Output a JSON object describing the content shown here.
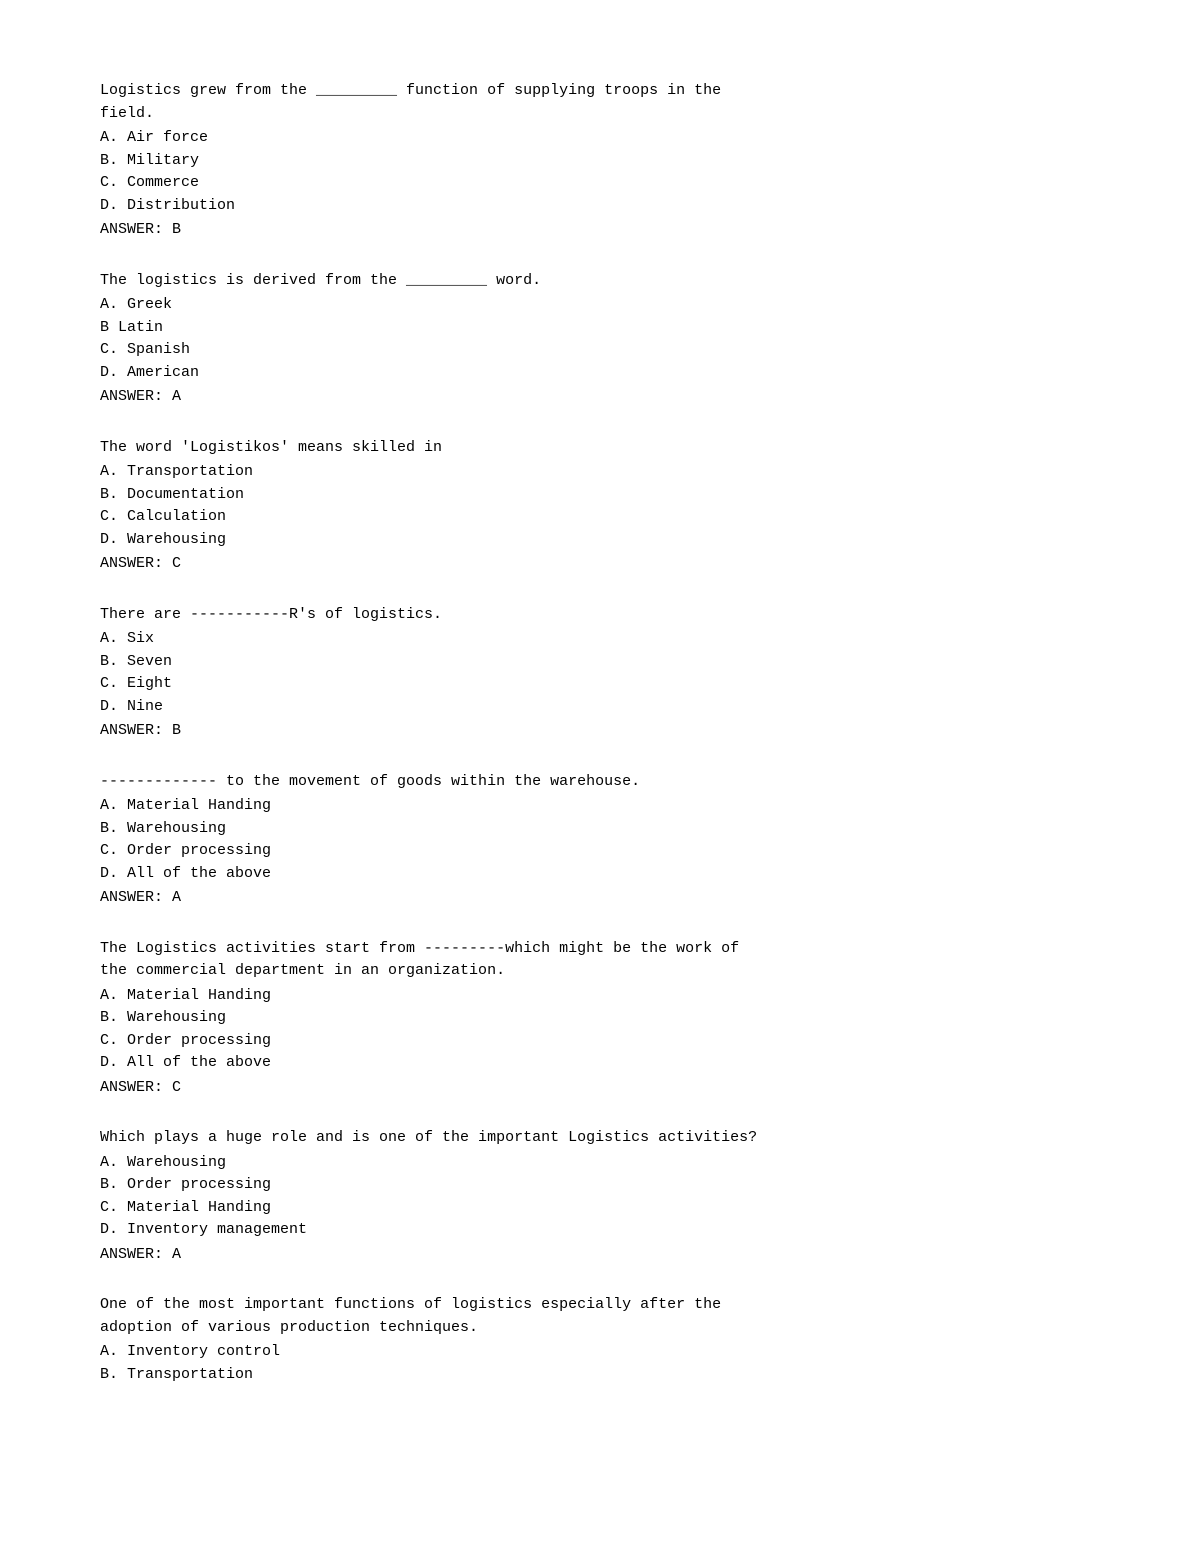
{
  "questions": [
    {
      "id": "q1",
      "text": "Logistics grew from the _________ function of supplying troops in the\nfield.",
      "options": [
        {
          "label": "A.",
          "text": "Air force"
        },
        {
          "label": "B.",
          "text": "Military"
        },
        {
          "label": "C.",
          "text": "Commerce"
        },
        {
          "label": "D.",
          "text": "Distribution"
        }
      ],
      "answer": "ANSWER: B"
    },
    {
      "id": "q2",
      "text": "The logistics is derived from the _________ word.",
      "options": [
        {
          "label": "A.",
          "text": "Greek"
        },
        {
          "label": "B",
          "text": "Latin"
        },
        {
          "label": "C.",
          "text": "Spanish"
        },
        {
          "label": "D.",
          "text": "American"
        }
      ],
      "answer": "ANSWER: A"
    },
    {
      "id": "q3",
      "text": "The word 'Logistikos' means skilled in",
      "options": [
        {
          "label": "A.",
          "text": "Transportation"
        },
        {
          "label": "B.",
          "text": "Documentation"
        },
        {
          "label": "C.",
          "text": "Calculation"
        },
        {
          "label": "D.",
          "text": "Warehousing"
        }
      ],
      "answer": "ANSWER: C"
    },
    {
      "id": "q4",
      "text": "There are -----------R's of logistics.",
      "options": [
        {
          "label": "A.",
          "text": "Six"
        },
        {
          "label": "B.",
          "text": "Seven"
        },
        {
          "label": "C.",
          "text": "Eight"
        },
        {
          "label": "D.",
          "text": "Nine"
        }
      ],
      "answer": "ANSWER: B"
    },
    {
      "id": "q5",
      "text": "------------- to the movement of goods within the warehouse.",
      "options": [
        {
          "label": "A.",
          "text": "Material Handing"
        },
        {
          "label": "B.",
          "text": "Warehousing"
        },
        {
          "label": "C.",
          "text": "Order processing"
        },
        {
          "label": "D.",
          "text": "All of the above"
        }
      ],
      "answer": "ANSWER: A"
    },
    {
      "id": "q6",
      "text": "The Logistics activities start from ---------which might be the work of\nthe commercial department in an organization.",
      "options": [
        {
          "label": "A.",
          "text": "Material Handing"
        },
        {
          "label": "B.",
          "text": "Warehousing"
        },
        {
          "label": "C.",
          "text": "Order processing"
        },
        {
          "label": "D.",
          "text": "All of the above"
        }
      ],
      "answer": "ANSWER: C"
    },
    {
      "id": "q7",
      "text": "Which plays a huge role and is one of the important Logistics activities?",
      "options": [
        {
          "label": "A.",
          "text": "   Warehousing"
        },
        {
          "label": "B.",
          "text": "   Order processing"
        },
        {
          "label": "C.",
          "text": "   Material Handing"
        },
        {
          "label": "D.",
          "text": "   Inventory management"
        }
      ],
      "answer": "ANSWER: A"
    },
    {
      "id": "q8",
      "text": "One of the most important functions of logistics especially after the\nadoption of various production techniques.",
      "options": [
        {
          "label": "A.",
          "text": "   Inventory control"
        },
        {
          "label": "B.",
          "text": "   Transportation"
        }
      ],
      "answer": ""
    }
  ]
}
